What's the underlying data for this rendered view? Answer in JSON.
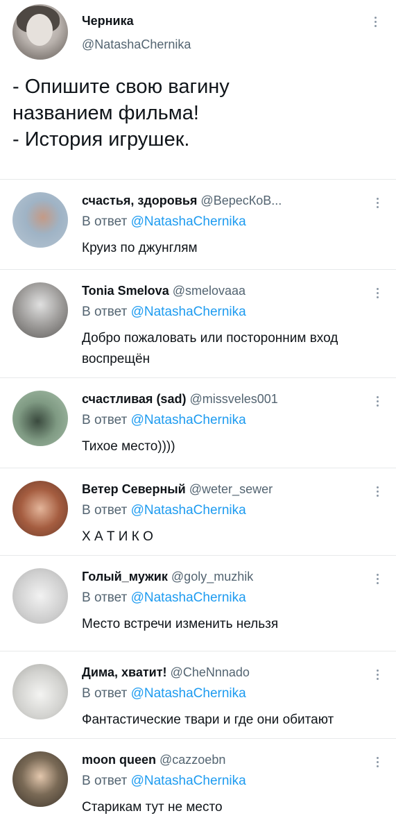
{
  "main_tweet": {
    "name": "Черника",
    "handle": "@NatashaChernika",
    "text": "- Опишите свою вагину\nназванием фильма!\n- История игрушек."
  },
  "replies": [
    {
      "name": "счастья, здоровья",
      "handle": "@ВересКоВ...",
      "replying_label": "В ответ",
      "mention": "@NatashaChernika",
      "text": "Круиз по джунглям",
      "avatar_color": "#a8b7c4"
    },
    {
      "name": "Tonia Smelova",
      "handle": "@smelovaaa",
      "replying_label": "В ответ",
      "mention": "@NatashaChernika",
      "text": "Добро пожаловать или посторонним вход воспрещён",
      "avatar_color": "#7d7b79"
    },
    {
      "name": "счастливая (sad)",
      "handle": "@missveles001",
      "replying_label": "В ответ",
      "mention": "@NatashaChernika",
      "text": "Тихое место))))",
      "avatar_color": "#6f8a73"
    },
    {
      "name": "Ветер Северный",
      "handle": "@weter_sewer",
      "replying_label": "В ответ",
      "mention": "@NatashaChernika",
      "text": "Х А Т И К О",
      "avatar_color": "#a56a52"
    },
    {
      "name": "Голый_мужик",
      "handle": "@goly_muzhik",
      "replying_label": "В ответ",
      "mention": "@NatashaChernika",
      "text": "Место встречи изменить нельзя",
      "avatar_color": "#d6d6d6"
    },
    {
      "name": "Дима, хватит!",
      "handle": "@CheNnnado",
      "replying_label": "В ответ",
      "mention": "@NatashaChernika",
      "text": "Фантастические твари и где они обитают",
      "avatar_color": "#c9c9c7"
    },
    {
      "name": "moon queen",
      "handle": "@cazzoebn",
      "replying_label": "В ответ",
      "mention": "@NatashaChernika",
      "text": "Старикам тут не место",
      "avatar_color": "#5a5045"
    }
  ]
}
